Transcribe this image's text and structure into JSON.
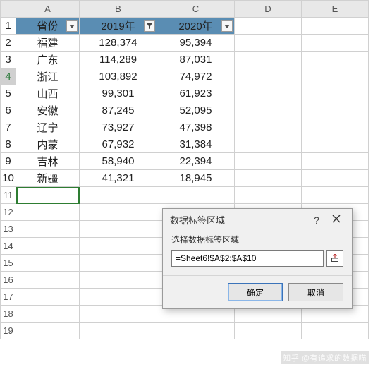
{
  "columns": [
    "A",
    "B",
    "C",
    "D",
    "E"
  ],
  "row_numbers": [
    1,
    2,
    3,
    4,
    5,
    6,
    7,
    8,
    9,
    10,
    11,
    12,
    13,
    14,
    15,
    16,
    17,
    18,
    19
  ],
  "selected_row_header_index": 3,
  "header": {
    "province": "省份",
    "y2019": "2019年",
    "y2020": "2020年"
  },
  "rows": [
    {
      "province": "福建",
      "y2019": "128,374",
      "y2020": "95,394"
    },
    {
      "province": "广东",
      "y2019": "114,289",
      "y2020": "87,031"
    },
    {
      "province": "浙江",
      "y2019": "103,892",
      "y2020": "74,972"
    },
    {
      "province": "山西",
      "y2019": "99,301",
      "y2020": "61,923"
    },
    {
      "province": "安徽",
      "y2019": "87,245",
      "y2020": "52,095"
    },
    {
      "province": "辽宁",
      "y2019": "73,927",
      "y2020": "47,398"
    },
    {
      "province": "内蒙",
      "y2019": "67,932",
      "y2020": "31,384"
    },
    {
      "province": "吉林",
      "y2019": "58,940",
      "y2020": "22,394"
    },
    {
      "province": "新疆",
      "y2019": "41,321",
      "y2020": "18,945"
    }
  ],
  "dialog": {
    "title": "数据标签区域",
    "label": "选择数据标签区域",
    "value": "=Sheet6!$A$2:$A$10",
    "ok": "确定",
    "cancel": "取消"
  },
  "watermark": "知乎 @有追求的数据喵",
  "chart_data": {
    "type": "table",
    "title": "",
    "columns": [
      "省份",
      "2019年",
      "2020年"
    ],
    "rows": [
      [
        "福建",
        128374,
        95394
      ],
      [
        "广东",
        114289,
        87031
      ],
      [
        "浙江",
        103892,
        74972
      ],
      [
        "山西",
        99301,
        61923
      ],
      [
        "安徽",
        87245,
        52095
      ],
      [
        "辽宁",
        73927,
        47398
      ],
      [
        "内蒙",
        67932,
        31384
      ],
      [
        "吉林",
        58940,
        22394
      ],
      [
        "新疆",
        41321,
        18945
      ]
    ]
  }
}
